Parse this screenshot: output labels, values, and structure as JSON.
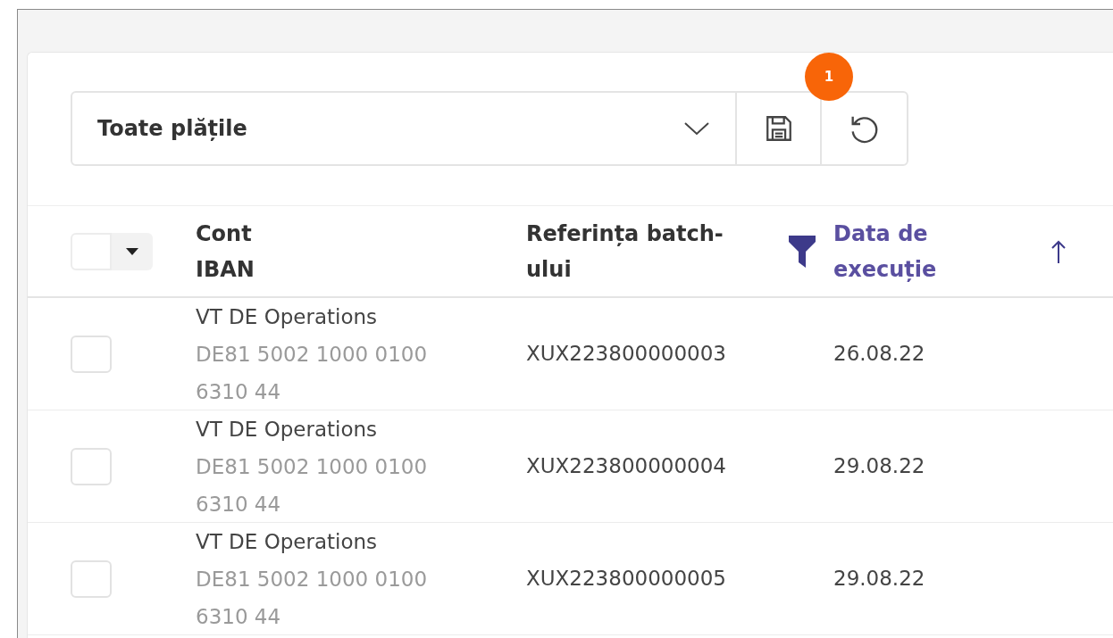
{
  "toolbar": {
    "view_select": {
      "value": "Toate plățile"
    },
    "badge": "1"
  },
  "table": {
    "select_all": {
      "checked": false
    },
    "columns": [
      {
        "lines": [
          "Cont",
          "IBAN"
        ],
        "sorted": false,
        "filtered": false
      },
      {
        "lines": [
          "Referința batch-",
          "ului"
        ],
        "sorted": false,
        "filtered": true
      },
      {
        "lines": [
          "Data de",
          "execuție"
        ],
        "sorted": true,
        "filtered": false
      }
    ],
    "rows": [
      {
        "checked": false,
        "account": "VT DE Operations",
        "iban": "DE81 5002 1000 0100 6310 44",
        "batch_ref": "XUX223800000003",
        "date": "26.08.22"
      },
      {
        "checked": false,
        "account": "VT DE Operations",
        "iban": "DE81 5002 1000 0100 6310 44",
        "batch_ref": "XUX223800000004",
        "date": "29.08.22"
      },
      {
        "checked": false,
        "account": "VT DE Operations",
        "iban": "DE81 5002 1000 0100 6310 44",
        "batch_ref": "XUX223800000005",
        "date": "29.08.22"
      }
    ]
  }
}
